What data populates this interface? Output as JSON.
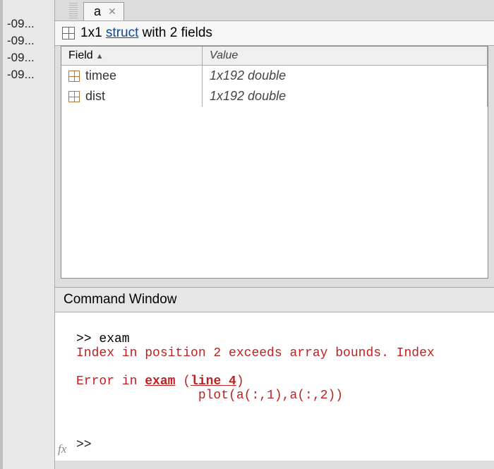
{
  "left_files": [
    "-09...",
    "-09...",
    "-09...",
    "-09..."
  ],
  "tab": {
    "name": "a",
    "close": "✕"
  },
  "struct_desc": {
    "prefix": "1x1 ",
    "link": "struct",
    "suffix": " with 2 fields"
  },
  "columns": {
    "field": "Field",
    "value": "Value"
  },
  "fields": [
    {
      "name": "timee",
      "value": "1x192 double"
    },
    {
      "name": "dist",
      "value": "1x192 double"
    }
  ],
  "cmd_title": "Command Window",
  "cmd": {
    "prompt1_prefix": ">> ",
    "prompt1_cmd": "exam",
    "err_line1": "Index in position 2 exceeds array bounds. Index",
    "err_line2a": "Error in ",
    "err_link": "exam",
    "err_line2b": " (",
    "err_line2_link2": "line 4",
    "err_line2c": ")",
    "err_line3": "                plot(a(:,1),a(:,2))",
    "fx": "fx",
    "prompt2": ">>"
  }
}
